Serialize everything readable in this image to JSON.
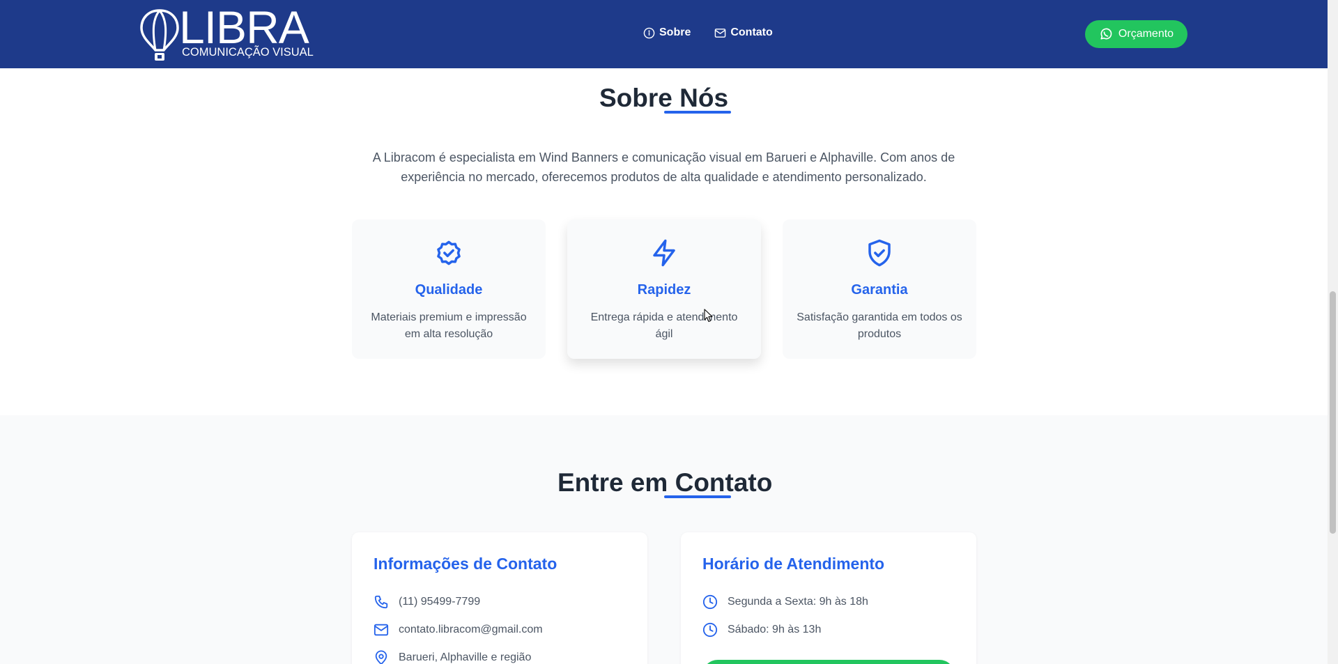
{
  "header": {
    "logo_word": "LIBRA",
    "logo_sub": "COMUNICAÇÃO VISUAL",
    "nav": [
      {
        "label": "Sobre",
        "icon": "info-icon"
      },
      {
        "label": "Contato",
        "icon": "mail-icon"
      }
    ],
    "cta_label": "Orçamento",
    "cta_icon": "whatsapp-icon"
  },
  "about": {
    "title": "Sobre Nós",
    "text": "A Libracom é especialista em Wind Banners e comunicação visual em Barueri e Alphaville. Com anos de experiência no mercado, oferecemos produtos de alta qualidade e atendimento personalizado.",
    "features": [
      {
        "title": "Qualidade",
        "desc": "Materiais premium e impressão em alta resolução",
        "icon": "badge-check-icon"
      },
      {
        "title": "Rapidez",
        "desc": "Entrega rápida e atendimento ágil",
        "icon": "lightning-icon"
      },
      {
        "title": "Garantia",
        "desc": "Satisfação garantida em todos os produtos",
        "icon": "shield-check-icon"
      }
    ]
  },
  "contact": {
    "title": "Entre em Contato",
    "info": {
      "title": "Informações de Contato",
      "items": [
        {
          "text": "(11) 95499-7799",
          "icon": "phone-icon"
        },
        {
          "text": "contato.libracom@gmail.com",
          "icon": "mail-icon"
        },
        {
          "text": "Barueri, Alphaville e região",
          "icon": "map-pin-icon"
        }
      ]
    },
    "hours": {
      "title": "Horário de Atendimento",
      "items": [
        {
          "text": "Segunda a Sexta: 9h às 18h",
          "icon": "clock-icon"
        },
        {
          "text": "Sábado: 9h às 13h",
          "icon": "clock-icon"
        }
      ]
    }
  },
  "colors": {
    "header_bg": "#1e3a8a",
    "accent": "#2563eb",
    "cta_green": "#22c55e"
  }
}
